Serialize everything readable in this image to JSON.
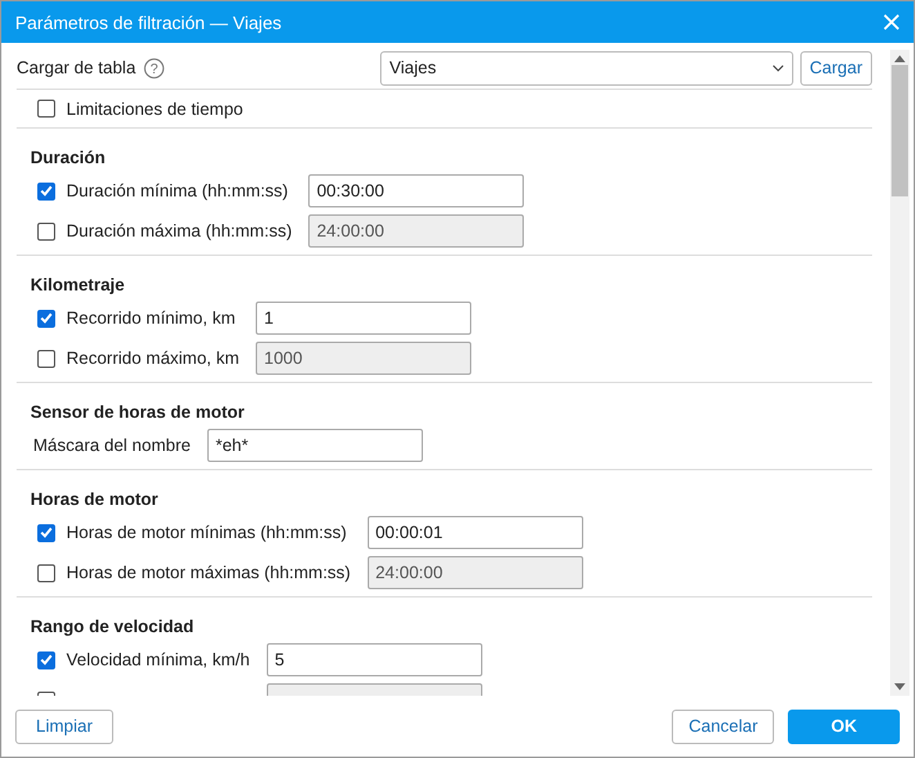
{
  "window": {
    "title": "Parámetros de filtración — Viajes"
  },
  "load_table": {
    "label": "Cargar de tabla",
    "help": "?",
    "select_value": "Viajes",
    "button": "Cargar"
  },
  "time_limits": {
    "label": "Limitaciones de tiempo",
    "checked": false
  },
  "sections": [
    {
      "title": "Duración",
      "rows": [
        {
          "kind": "check",
          "label": "Duración mínima (hh:mm:ss)",
          "checked": true,
          "disabled": false,
          "value": "00:30:00"
        },
        {
          "kind": "check",
          "label": "Duración máxima (hh:mm:ss)",
          "checked": false,
          "disabled": true,
          "value": "24:00:00"
        }
      ]
    },
    {
      "title": "Kilometraje",
      "rows": [
        {
          "kind": "check",
          "label": "Recorrido mínimo, km",
          "checked": true,
          "disabled": false,
          "value": "1"
        },
        {
          "kind": "check",
          "label": "Recorrido máximo, km",
          "checked": false,
          "disabled": true,
          "value": "1000"
        }
      ]
    },
    {
      "title": "Sensor de horas de motor",
      "rows": [
        {
          "kind": "plain",
          "label": "Máscara del nombre",
          "value": "*eh*"
        }
      ]
    },
    {
      "title": "Horas de motor",
      "rows": [
        {
          "kind": "check",
          "label": "Horas de motor mínimas (hh:mm:ss)",
          "checked": true,
          "disabled": false,
          "value": "00:00:01"
        },
        {
          "kind": "check",
          "label": "Horas de motor máximas (hh:mm:ss)",
          "checked": false,
          "disabled": true,
          "value": "24:00:00"
        }
      ]
    },
    {
      "title": "Rango de velocidad",
      "rows": [
        {
          "kind": "check",
          "label": "Velocidad mínima, km/h",
          "checked": true,
          "disabled": false,
          "value": "5"
        },
        {
          "kind": "check",
          "checked": false,
          "disabled": true
        }
      ]
    }
  ],
  "footer": {
    "clear": "Limpiar",
    "cancel": "Cancelar",
    "ok": "OK"
  }
}
